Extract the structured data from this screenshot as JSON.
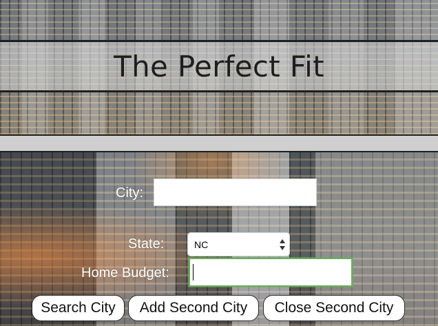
{
  "header": {
    "title": "The Perfect Fit"
  },
  "form": {
    "city": {
      "label": "City:",
      "value": "",
      "placeholder": ""
    },
    "state": {
      "label": "State:",
      "selected": "NC"
    },
    "budget": {
      "label": "Home Budget:",
      "value": "",
      "placeholder": ""
    }
  },
  "buttons": {
    "search": "Search City",
    "add_second": "Add Second City",
    "close_second": "Close Second City"
  },
  "colors": {
    "band_border": "#1e1e1e",
    "focus_border": "#6cae5b",
    "label_text": "#ffffff"
  }
}
